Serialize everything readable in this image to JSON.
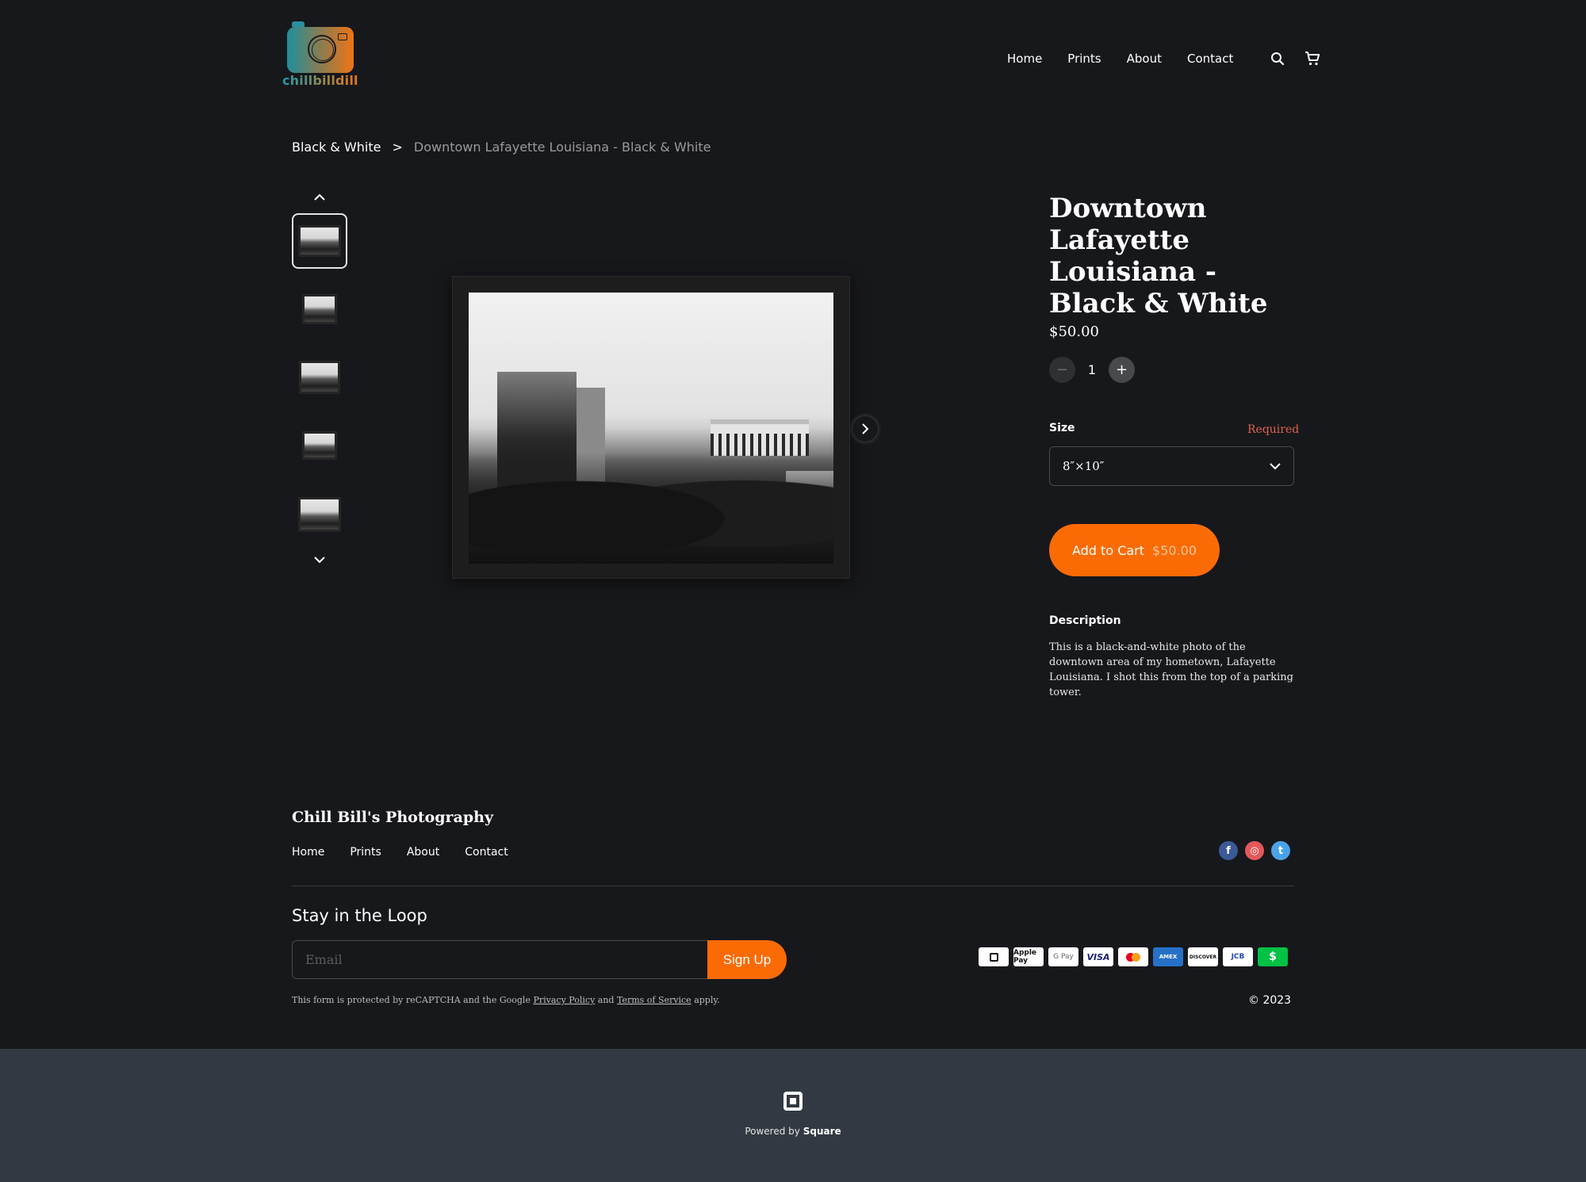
{
  "header": {
    "logo_text": "chillbilldill",
    "nav": [
      "Home",
      "Prints",
      "About",
      "Contact"
    ],
    "icons": [
      "search-icon",
      "cart-icon"
    ]
  },
  "breadcrumb": {
    "parent": "Black & White",
    "separator": ">",
    "current": "Downtown Lafayette Louisiana - Black & White"
  },
  "gallery": {
    "thumbnail_count": 5,
    "active_index": 0,
    "icons": [
      "chevron-up-icon",
      "chevron-down-icon",
      "chevron-right-icon"
    ]
  },
  "product": {
    "title": "Downtown Lafayette Louisiana - Black & White",
    "price": "$50.00",
    "quantity": "1",
    "qty_minus": "−",
    "qty_plus": "+",
    "size_label": "Size",
    "size_required": "Required",
    "size_value": "8″×10″",
    "add_to_cart_label": "Add to Cart",
    "add_to_cart_price": "$50.00",
    "description_label": "Description",
    "description": "This is a black-and-white photo of the downtown area of my hometown, Lafayette Louisiana. I shot this from the top of a parking tower."
  },
  "footer": {
    "brand": "Chill Bill's Photography",
    "nav": [
      "Home",
      "Prints",
      "About",
      "Contact"
    ],
    "social": [
      {
        "name": "facebook",
        "glyph": "f",
        "color": "#3b5998"
      },
      {
        "name": "instagram",
        "glyph": "◎",
        "color": "#e4585a"
      },
      {
        "name": "twitter",
        "glyph": "t",
        "color": "#4aa3e8"
      }
    ],
    "newsletter_title": "Stay in the Loop",
    "email_placeholder": "Email",
    "email_value": "",
    "signup_label": "Sign Up",
    "recaptcha_prefix": "This form is protected by reCAPTCHA and the Google",
    "privacy_link": "Privacy Policy",
    "recaptcha_and": "and",
    "terms_link": "Terms of Service",
    "recaptcha_suffix": "apply.",
    "payments": [
      "Square",
      "Apple Pay",
      "G Pay",
      "VISA",
      "Mastercard",
      "AMEX",
      "DISCOVER",
      "JCB",
      "Cash App"
    ],
    "copyright": "© 2023"
  },
  "powered_by": {
    "prefix": "Powered by",
    "brand": "Square"
  },
  "colors": {
    "background": "#17181b",
    "accent": "#fb6b05",
    "required": "#e0614f",
    "powered_bg": "#323942"
  }
}
